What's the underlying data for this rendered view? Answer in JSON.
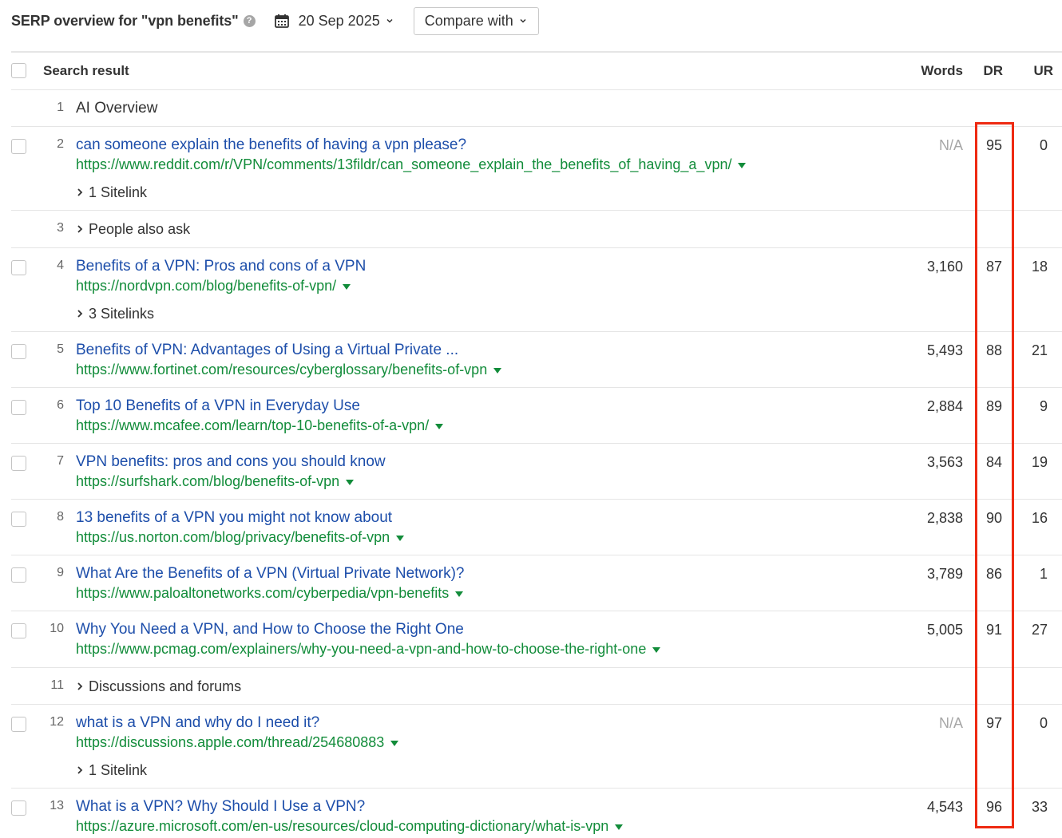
{
  "header": {
    "title": "SERP overview for \"vpn benefits\"",
    "help": "?",
    "date": "20 Sep 2025",
    "compare_label": "Compare with"
  },
  "table": {
    "col_search_result": "Search result",
    "col_words": "Words",
    "col_dr": "DR",
    "col_ur": "UR"
  },
  "rows": [
    {
      "pos": "1",
      "label": "AI Overview"
    },
    {
      "pos": "2",
      "title": "can someone explain the benefits of having a vpn please?",
      "url": "https://www.reddit.com/r/VPN/comments/13fildr/can_someone_explain_the_benefits_of_having_a_vpn/",
      "sitelinks": "1 Sitelink",
      "words": "N/A",
      "dr": "95",
      "ur": "0"
    },
    {
      "pos": "3",
      "label": "People also ask"
    },
    {
      "pos": "4",
      "title": "Benefits of a VPN: Pros and cons of a VPN",
      "url": "https://nordvpn.com/blog/benefits-of-vpn/",
      "sitelinks": "3 Sitelinks",
      "words": "3,160",
      "dr": "87",
      "ur": "18"
    },
    {
      "pos": "5",
      "title": "Benefits of VPN: Advantages of Using a Virtual Private ...",
      "url": "https://www.fortinet.com/resources/cyberglossary/benefits-of-vpn",
      "words": "5,493",
      "dr": "88",
      "ur": "21"
    },
    {
      "pos": "6",
      "title": "Top 10 Benefits of a VPN in Everyday Use",
      "url": "https://www.mcafee.com/learn/top-10-benefits-of-a-vpn/",
      "words": "2,884",
      "dr": "89",
      "ur": "9"
    },
    {
      "pos": "7",
      "title": "VPN benefits: pros and cons you should know",
      "url": "https://surfshark.com/blog/benefits-of-vpn",
      "words": "3,563",
      "dr": "84",
      "ur": "19"
    },
    {
      "pos": "8",
      "title": "13 benefits of a VPN you might not know about",
      "url": "https://us.norton.com/blog/privacy/benefits-of-vpn",
      "words": "2,838",
      "dr": "90",
      "ur": "16"
    },
    {
      "pos": "9",
      "title": "What Are the Benefits of a VPN (Virtual Private Network)?",
      "url": "https://www.paloaltonetworks.com/cyberpedia/vpn-benefits",
      "words": "3,789",
      "dr": "86",
      "ur": "1"
    },
    {
      "pos": "10",
      "title": "Why You Need a VPN, and How to Choose the Right One",
      "url": "https://www.pcmag.com/explainers/why-you-need-a-vpn-and-how-to-choose-the-right-one",
      "words": "5,005",
      "dr": "91",
      "ur": "27"
    },
    {
      "pos": "11",
      "label": "Discussions and forums"
    },
    {
      "pos": "12",
      "title": "what is a VPN and why do I need it?",
      "url": "https://discussions.apple.com/thread/254680883",
      "sitelinks": "1 Sitelink",
      "words": "N/A",
      "dr": "97",
      "ur": "0"
    },
    {
      "pos": "13",
      "title": "What is a VPN? Why Should I Use a VPN?",
      "url": "https://azure.microsoft.com/en-us/resources/cloud-computing-dictionary/what-is-vpn",
      "words": "4,543",
      "dr": "96",
      "ur": "33"
    }
  ],
  "colors": {
    "title_link": "#1d4eaa",
    "url": "#128c3a",
    "highlight": "#ee2a12"
  }
}
